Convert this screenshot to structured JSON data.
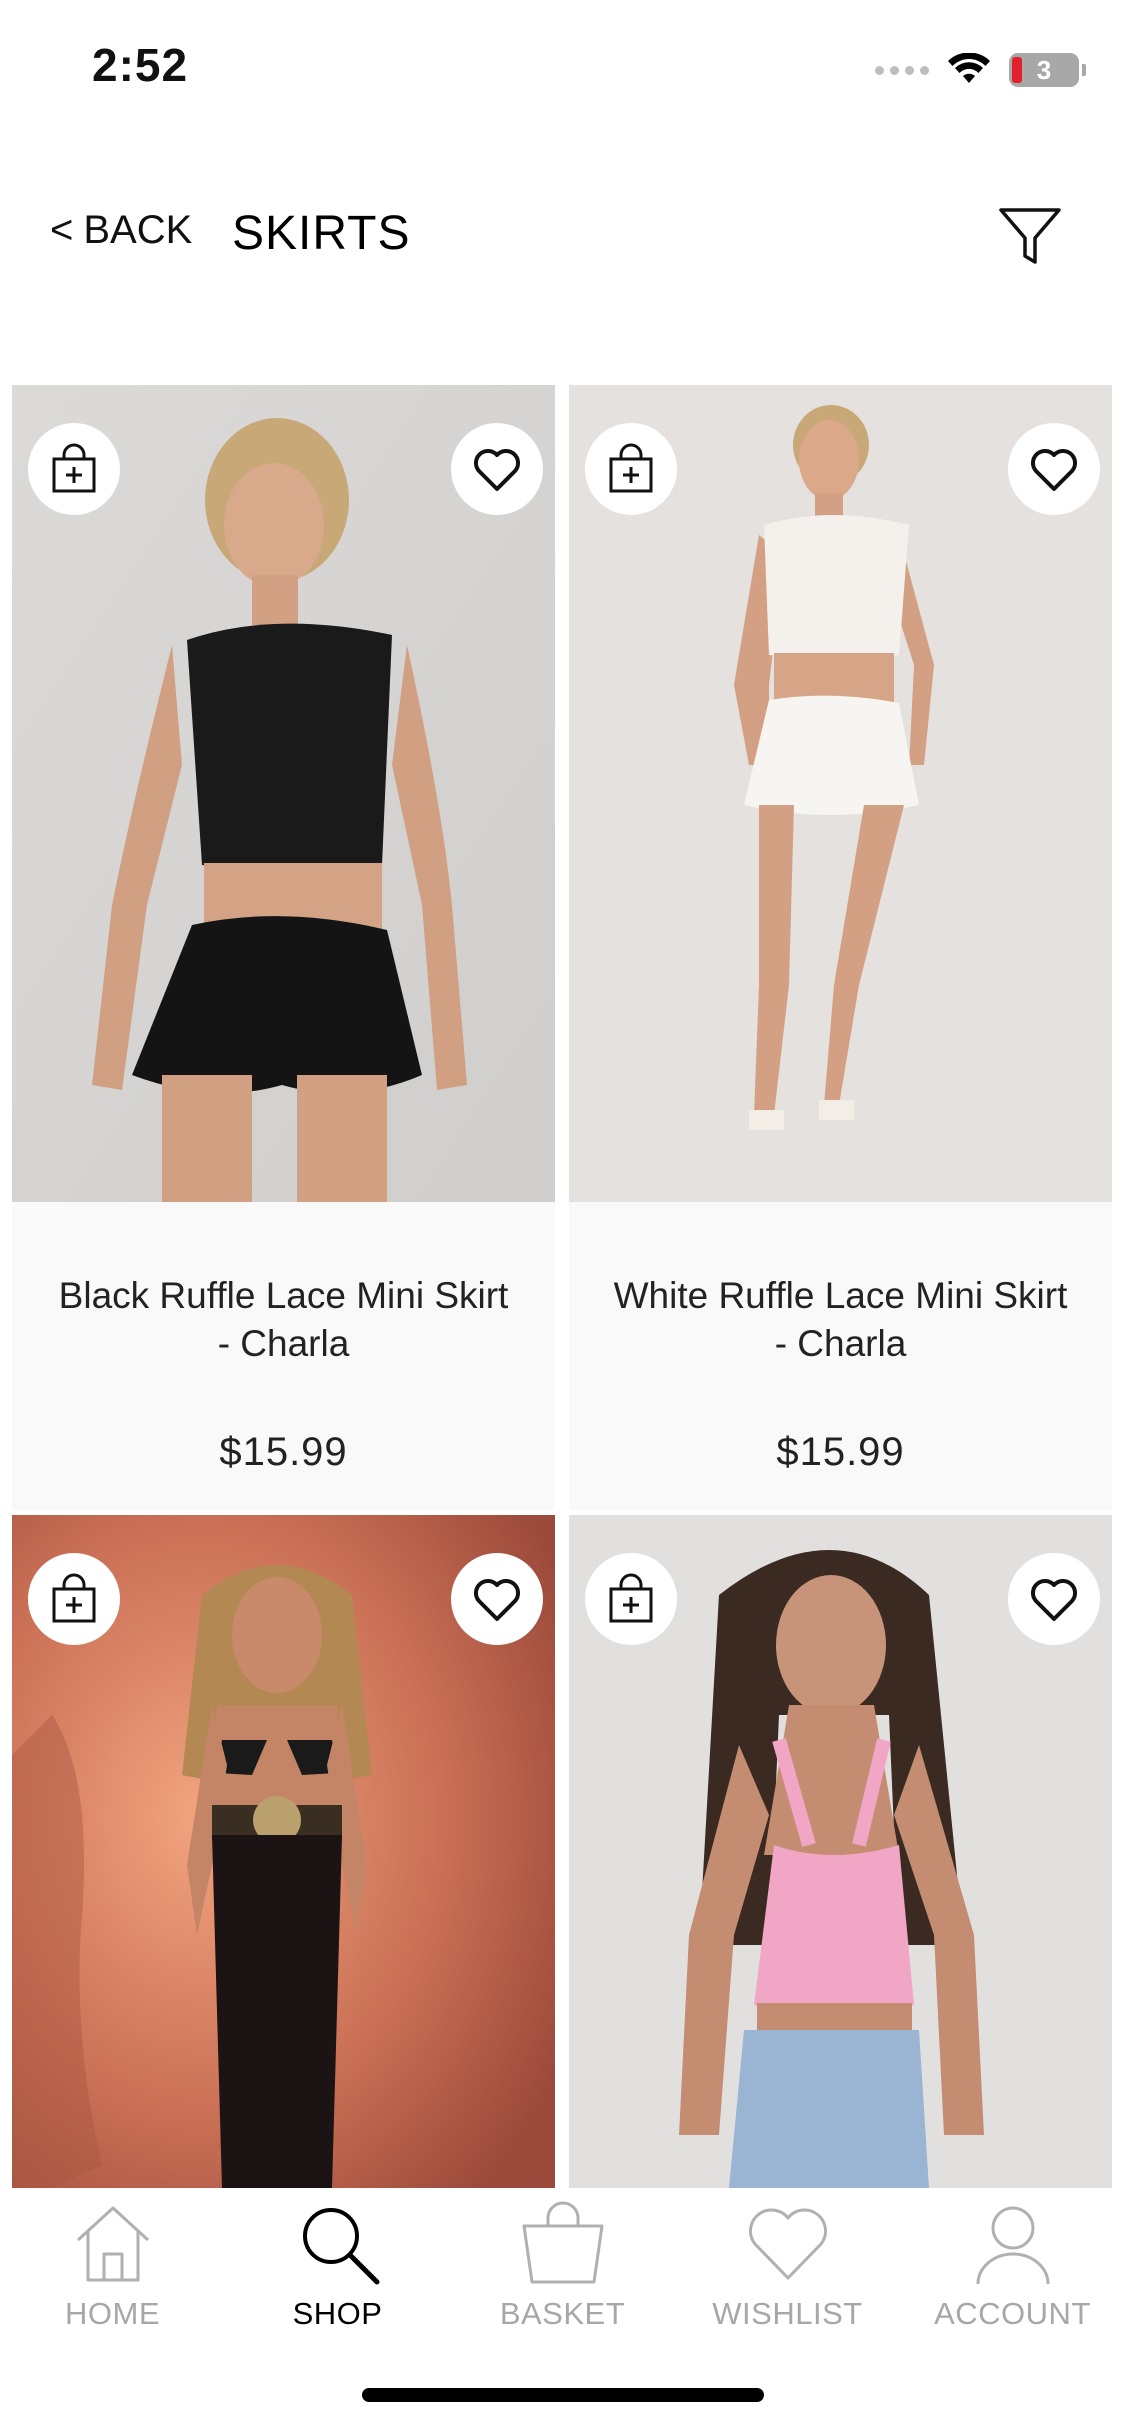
{
  "status_bar": {
    "time": "2:52",
    "battery_level": "3",
    "battery_color": "#e0212d"
  },
  "header": {
    "back_label": "BACK",
    "back_chevron": "<",
    "title": "SKIRTS",
    "filter_icon": "funnel-icon"
  },
  "products": [
    {
      "name": "Black Ruffle Lace Mini Skirt - Charla",
      "price": "$15.99",
      "image_desc": "model-black-crop-top-black-lace-skirt",
      "bag_icon": "add-to-bag-icon",
      "wishlist_icon": "heart-icon"
    },
    {
      "name": "White Ruffle Lace Mini Skirt - Charla",
      "price": "$15.99",
      "image_desc": "model-white-crop-top-white-lace-skirt",
      "bag_icon": "add-to-bag-icon",
      "wishlist_icon": "heart-icon"
    },
    {
      "name": "",
      "price": "",
      "image_desc": "model-black-bikini-top-black-lace-maxi-skirt",
      "bag_icon": "add-to-bag-icon",
      "wishlist_icon": "heart-icon"
    },
    {
      "name": "",
      "price": "",
      "image_desc": "model-pink-lace-halter-top-denim",
      "bag_icon": "add-to-bag-icon",
      "wishlist_icon": "heart-icon"
    }
  ],
  "tab_bar": {
    "tabs": [
      {
        "label": "HOME",
        "icon": "home-icon",
        "active": false
      },
      {
        "label": "SHOP",
        "icon": "search-icon",
        "active": true
      },
      {
        "label": "BASKET",
        "icon": "basket-icon",
        "active": false
      },
      {
        "label": "WISHLIST",
        "icon": "heart-icon",
        "active": false
      },
      {
        "label": "ACCOUNT",
        "icon": "user-icon",
        "active": false
      }
    ]
  },
  "colors": {
    "active_tab": "#000000",
    "inactive_tab": "#a7a7a7",
    "card_background": "#f9f9f9"
  }
}
